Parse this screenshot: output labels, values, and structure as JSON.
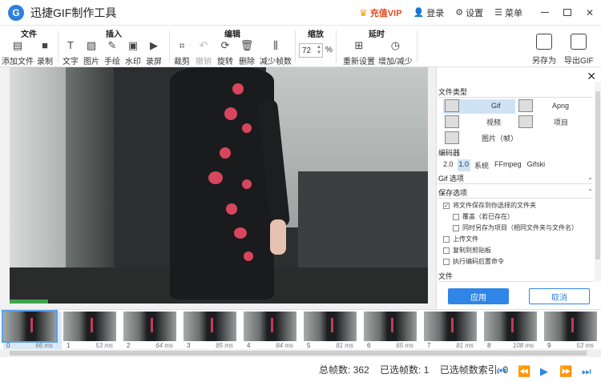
{
  "titlebar": {
    "title": "迅捷GIF制作工具",
    "vip": "充值VIP",
    "login": "登录",
    "settings": "设置",
    "menu": "菜单"
  },
  "toolbar": {
    "groups": {
      "file": "文件",
      "insert": "插入",
      "edit": "编辑",
      "zoom": "缩放",
      "delay": "延时"
    },
    "add_file": "添加文件",
    "record": "录制",
    "text": "文字",
    "image": "图片",
    "draw": "手绘",
    "watermark": "水印",
    "record_screen": "录屏",
    "crop": "裁剪",
    "undo": "撤销",
    "rotate": "旋转",
    "delete": "删除",
    "reduce_frames": "减少帧数",
    "zoom_value": "72",
    "zoom_unit": "%",
    "reset": "重新设置",
    "inc_dec": "增加/减少",
    "save_as": "另存为",
    "export_gif": "导出GIF"
  },
  "panel": {
    "file_type_title": "文件类型",
    "gif": "Gif",
    "apng": "Apng",
    "video": "视频",
    "project": "项目",
    "image_frames": "图片（帧）",
    "encoder_title": "编码器",
    "encoders": [
      "2.0",
      "1.0",
      "系统",
      "FFmpeg",
      "Gifski"
    ],
    "gif_options": "Gif 选项",
    "save_options": "保存选项",
    "opt_save_folder": "将文件保存到你选择的文件夹",
    "opt_overwrite": "覆盖（若已存在）",
    "opt_save_project": "同时另存为项目（相同文件夹与文件名）",
    "opt_upload": "上传文件",
    "opt_clipboard": "复制到剪贴板",
    "opt_run_cmd": "执行编码后置命令",
    "file_section": "文件",
    "apply": "应用",
    "cancel": "取消"
  },
  "frames": [
    {
      "index": "0",
      "delay": "66 ms"
    },
    {
      "index": "1",
      "delay": "53 ms"
    },
    {
      "index": "2",
      "delay": "64 ms"
    },
    {
      "index": "3",
      "delay": "85 ms"
    },
    {
      "index": "4",
      "delay": "84 ms"
    },
    {
      "index": "5",
      "delay": "81 ms"
    },
    {
      "index": "6",
      "delay": "65 ms"
    },
    {
      "index": "7",
      "delay": "81 ms"
    },
    {
      "index": "8",
      "delay": "108 ms"
    },
    {
      "index": "9",
      "delay": "53 ms"
    }
  ],
  "status": {
    "total_frames": "总帧数: 362",
    "selected_frames": "已选帧数: 1",
    "selected_index": "已选帧数索引: 0"
  },
  "colors": {
    "accent": "#2f86e6",
    "vip": "#e24a1f",
    "progress": "#3fa34d"
  }
}
